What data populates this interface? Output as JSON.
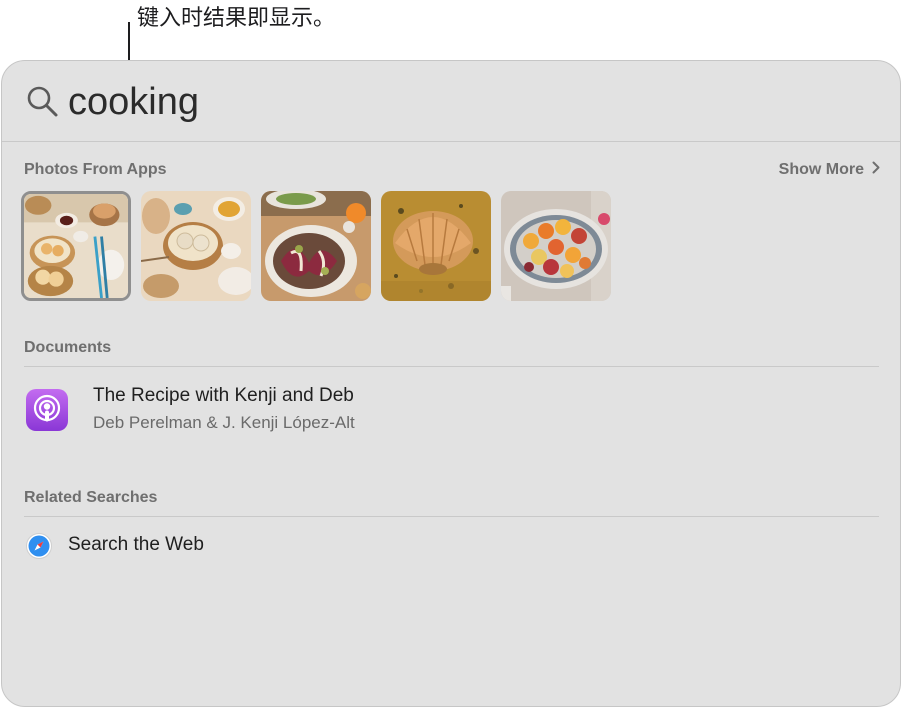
{
  "callout": {
    "text": "键入时结果即显示。"
  },
  "search": {
    "query": "cooking",
    "icon": "search-icon"
  },
  "sections": {
    "photos": {
      "title": "Photos From Apps",
      "show_more": "Show More",
      "items": [
        {
          "name": "photo-dim-sum",
          "selected": true
        },
        {
          "name": "photo-dumplings",
          "selected": false
        },
        {
          "name": "photo-salad",
          "selected": false
        },
        {
          "name": "photo-scallop-dish",
          "selected": false
        },
        {
          "name": "photo-citrus-platter",
          "selected": false
        }
      ]
    },
    "documents": {
      "title": "Documents",
      "items": [
        {
          "title": "The Recipe with Kenji and Deb",
          "subtitle": "Deb Perelman & J. Kenji López-Alt",
          "icon": "podcast-icon"
        }
      ]
    },
    "related": {
      "title": "Related Searches",
      "items": [
        {
          "label": "Search the Web",
          "icon": "safari-icon"
        }
      ]
    }
  },
  "colors": {
    "panel_bg": "#e2e2e2",
    "podcast_purple": "#9a45e0",
    "safari_blue": "#2f8ff0"
  }
}
